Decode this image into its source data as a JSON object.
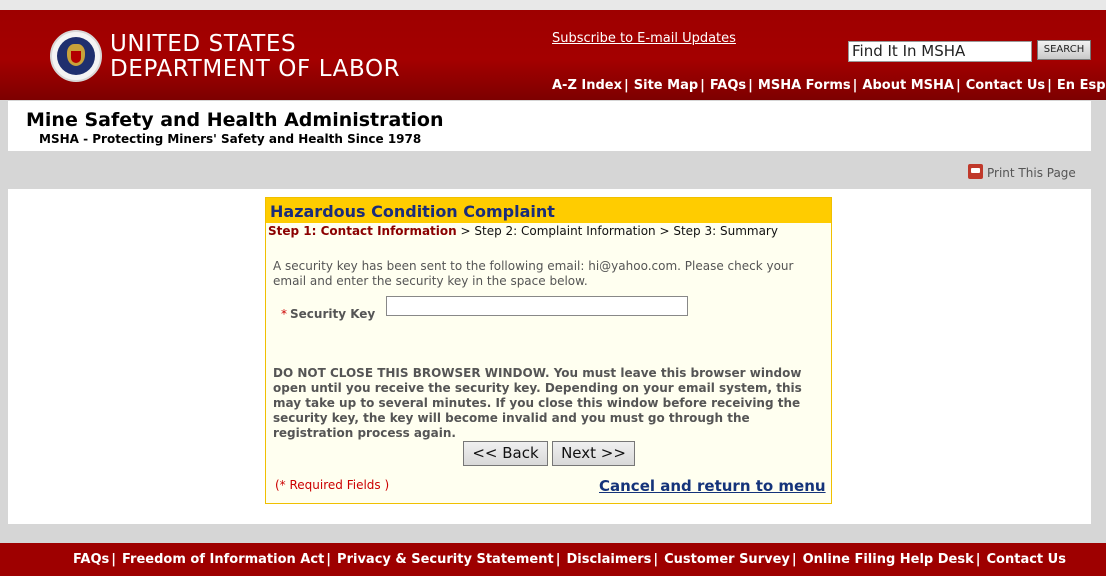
{
  "header": {
    "agency_line1": "UNITED STATES",
    "agency_line2": "DEPARTMENT OF LABOR",
    "subscribe": "Subscribe to E-mail Updates",
    "search_placeholder": "Find It In MSHA",
    "search_button": "SEARCH",
    "nav": [
      {
        "label": "A-Z Index"
      },
      {
        "label": "Site Map"
      },
      {
        "label": "FAQs"
      },
      {
        "label": "MSHA Forms"
      },
      {
        "label": "About MSHA"
      },
      {
        "label": "Contact Us"
      },
      {
        "label": "En Español"
      }
    ],
    "separator": "|"
  },
  "titlebar": {
    "title": "Mine Safety and Health Administration",
    "subtitle": "MSHA - Protecting Miners' Safety and Health Since 1978"
  },
  "print": {
    "label": "Print This Page"
  },
  "form": {
    "heading": "Hazardous Condition Complaint",
    "steps": {
      "step1": "Step 1: Contact Information",
      "sep": " > ",
      "step2": "Step 2: Complaint Information",
      "step3": "Step 3: Summary"
    },
    "info": "A security key has been sent to the following email: hi@yahoo.com. Please check your email and enter the security key in the space below.",
    "required_mark": "*",
    "key_label": "Security Key",
    "key_value": "",
    "warning": "DO NOT CLOSE THIS BROWSER WINDOW. You must leave this browser window open until you receive the security key. Depending on your email system, this may take up to several minutes. If you close this window before receiving the security key, the key will become invalid and you must go through the registration process again.",
    "back_button": "<< Back",
    "next_button": "Next >>",
    "required_note": "(* Required Fields )",
    "cancel": "Cancel and return to menu"
  },
  "footer": {
    "links": [
      {
        "label": "FAQs"
      },
      {
        "label": "Freedom of Information Act"
      },
      {
        "label": "Privacy & Security Statement"
      },
      {
        "label": "Disclaimers"
      },
      {
        "label": "Customer Survey"
      },
      {
        "label": "Online Filing Help Desk"
      },
      {
        "label": "Contact Us"
      }
    ],
    "separator": "|"
  },
  "colors": {
    "brand_red": "#9e0000",
    "form_header": "#ffcc00",
    "heading_blue": "#1a2c7a",
    "step_active": "#8b0000",
    "required_red": "#cc0000"
  },
  "icons": [
    "dol-seal-icon",
    "printer-icon"
  ]
}
